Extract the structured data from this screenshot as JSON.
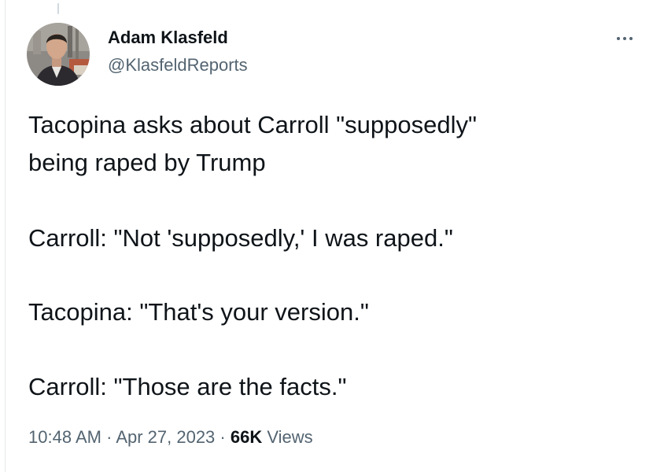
{
  "author": {
    "name": "Adam Klasfeld",
    "handle": "@KlasfeldReports"
  },
  "tweet": {
    "lines": [
      "Tacopina asks about Carroll \"supposedly\"",
      "being raped by Trump",
      "Carroll: \"Not 'supposedly,' I was raped.\"",
      "Tacopina: \"That's your version.\"",
      "Carroll: \"Those are the facts.\""
    ]
  },
  "meta": {
    "time": "10:48 AM",
    "separator": "·",
    "date": "Apr 27, 2023",
    "views_count": "66K",
    "views_label": "Views"
  },
  "icons": {
    "more": "more-horizontal-icon"
  },
  "colors": {
    "text_primary": "#0f1419",
    "text_secondary": "#536471",
    "background": "#ffffff"
  }
}
